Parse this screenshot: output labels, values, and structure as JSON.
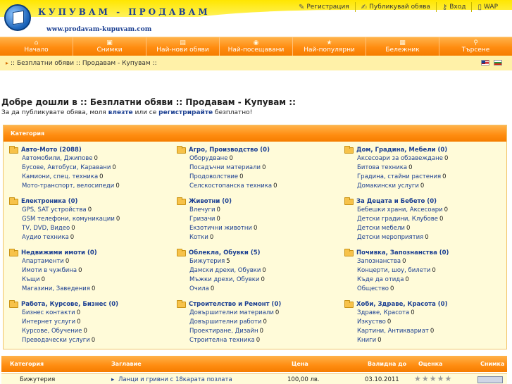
{
  "header": {
    "logo_title": "КУПУВАМ - ПРОДАВАМ",
    "logo_url": "www.prodavam-kupuvam.com",
    "links": [
      {
        "label": "Регистрация",
        "icon": "pencil-icon"
      },
      {
        "label": "Публикувай обява",
        "icon": "edit-icon"
      },
      {
        "label": "Вход",
        "icon": "key-icon"
      },
      {
        "label": "WAP",
        "icon": "mobile-icon"
      }
    ]
  },
  "nav": [
    {
      "label": "Начало",
      "icon": "home-icon"
    },
    {
      "label": "Снимки",
      "icon": "camera-icon"
    },
    {
      "label": "Най-нови обяви",
      "icon": "new-icon"
    },
    {
      "label": "Най-посещавани",
      "icon": "eye-icon"
    },
    {
      "label": "Най-популярни",
      "icon": "star-icon"
    },
    {
      "label": "Бележник",
      "icon": "notebook-icon"
    },
    {
      "label": "Търсене",
      "icon": "search-icon"
    }
  ],
  "breadcrumb": ":: Безплатни обяви :: Продавам - Купувам ::",
  "welcome": {
    "title": "Добре дошли в :: Безплатни обяви :: Продавам - Купувам ::",
    "pre": "За да публикувате обява, моля ",
    "login": "влезте",
    "mid": " или се ",
    "register": "регистрирайте",
    "post": " безплатно!"
  },
  "categories_header": "Категория",
  "categories": [
    {
      "title": "Авто-Мото (2088)",
      "subs": [
        [
          "Автомобили, Джипове",
          "0"
        ],
        [
          "Бусове, Автобуси, Каравани",
          "0"
        ],
        [
          "Камиони, спец. техника",
          "0"
        ],
        [
          "Мото-транспорт, велосипеди",
          "0"
        ]
      ]
    },
    {
      "title": "Агро, Производство (0)",
      "subs": [
        [
          "Оборудване",
          "0"
        ],
        [
          "Посадъчни материали",
          "0"
        ],
        [
          "Продоволствие",
          "0"
        ],
        [
          "Селскостопанска техника",
          "0"
        ]
      ]
    },
    {
      "title": "Дом, Градина, Мебели (0)",
      "subs": [
        [
          "Аксесоари за обзавеждане",
          "0"
        ],
        [
          "Битова техника",
          "0"
        ],
        [
          "Градина, стайни растения",
          "0"
        ],
        [
          "Домакински услуги",
          "0"
        ]
      ]
    },
    {
      "title": "Електроника (0)",
      "subs": [
        [
          "GPS, SAT устройства",
          "0"
        ],
        [
          "GSM телефони, комуникации",
          "0"
        ],
        [
          "TV, DVD, Видео",
          "0"
        ],
        [
          "Аудио техника",
          "0"
        ]
      ]
    },
    {
      "title": "Животни (0)",
      "subs": [
        [
          "Влечуги",
          "0"
        ],
        [
          "Гризачи",
          "0"
        ],
        [
          "Екзотични животни",
          "0"
        ],
        [
          "Котки",
          "0"
        ]
      ]
    },
    {
      "title": "За Децата и Бебето (0)",
      "subs": [
        [
          "Бебешки храни, Аксесоари",
          "0"
        ],
        [
          "Детски градини, Клубове",
          "0"
        ],
        [
          "Детски мебели",
          "0"
        ],
        [
          "Детски мероприятия",
          "0"
        ]
      ]
    },
    {
      "title": "Недвижими имоти (0)",
      "subs": [
        [
          "Апартаменти",
          "0"
        ],
        [
          "Имоти в чужбина",
          "0"
        ],
        [
          "Къщи",
          "0"
        ],
        [
          "Магазини, Заведения",
          "0"
        ]
      ]
    },
    {
      "title": "Облекла, Обувки (5)",
      "subs": [
        [
          "Бижутерия",
          "5"
        ],
        [
          "Дамски дрехи, Обувки",
          "0"
        ],
        [
          "Мъжки дрехи, Обувки",
          "0"
        ],
        [
          "Очила",
          "0"
        ]
      ]
    },
    {
      "title": "Почивка, Запознанства (0)",
      "subs": [
        [
          "Запознанства",
          "0"
        ],
        [
          "Концерти, шоу, билети",
          "0"
        ],
        [
          "Къде да отида",
          "0"
        ],
        [
          "Общество",
          "0"
        ]
      ]
    },
    {
      "title": "Работа, Курсове, Бизнес (0)",
      "subs": [
        [
          "Бизнес контакти",
          "0"
        ],
        [
          "Интернет услуги",
          "0"
        ],
        [
          "Курсове, Обучение",
          "0"
        ],
        [
          "Преводачески услуги",
          "0"
        ]
      ]
    },
    {
      "title": "Строителство и Ремонт (0)",
      "subs": [
        [
          "Довършителни материали",
          "0"
        ],
        [
          "Довършителни работи",
          "0"
        ],
        [
          "Проектиране, Дизайн",
          "0"
        ],
        [
          "Строителна техника",
          "0"
        ]
      ]
    },
    {
      "title": "Хоби, Здраве, Красота (0)",
      "subs": [
        [
          "Здраве, Красота",
          "0"
        ],
        [
          "Изкуство",
          "0"
        ],
        [
          "Картини, Антиквариат",
          "0"
        ],
        [
          "Книги",
          "0"
        ]
      ]
    }
  ],
  "listing": {
    "headers": {
      "category": "Категория",
      "title": "Заглавие",
      "price": "Цена",
      "valid": "Валидна до",
      "rating": "Оценка",
      "image": "Снимка"
    },
    "rows": [
      {
        "category": "Бижутерия",
        "title": "Ланци и гривни с 18карата позлата",
        "price": "100,00 лв.",
        "valid": "03.10.2011"
      }
    ]
  },
  "colors": {
    "accent_orange": "#ff8c10",
    "header_yellow": "#ffe600",
    "link_blue": "#1b3f92",
    "panel_bg": "#fffbd9"
  }
}
